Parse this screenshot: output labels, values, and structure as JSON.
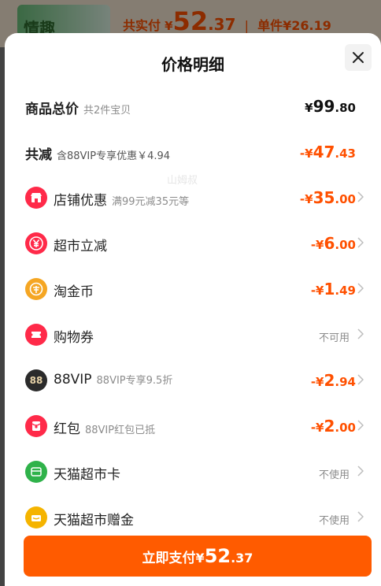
{
  "background": {
    "thumb_text": "情趣",
    "total_label": "共实付",
    "total_currency": "¥",
    "total_int": "52",
    "total_dec": ".37",
    "separator": "|",
    "unit_label": "单件",
    "unit_price": "¥26.19"
  },
  "sheet": {
    "title": "价格明细",
    "watermark": "山姆叔"
  },
  "summary": {
    "goods_total": {
      "label": "商品总价",
      "sub": "共2件宝贝",
      "currency": "¥",
      "int": "99",
      "dec": ".80"
    },
    "total_discount": {
      "label": "共减",
      "sub": "含88VIP专享优惠￥4.94",
      "sign": "-¥",
      "int": "47",
      "dec": ".43"
    }
  },
  "discounts": [
    {
      "label": "店铺优惠",
      "sub": "满99元减35元等",
      "sign": "-¥",
      "int": "35",
      "dec": ".00",
      "icon": "shop-icon",
      "color": "#ff2a49"
    },
    {
      "label": "超市立减",
      "sub": "",
      "sign": "-¥",
      "int": "6",
      "dec": ".00",
      "icon": "coupon-yen-icon",
      "color": "#ff2a49"
    },
    {
      "label": "淘金币",
      "sub": "",
      "sign": "-¥",
      "int": "1",
      "dec": ".49",
      "icon": "gold-coin-icon",
      "color": "#f5a623"
    },
    {
      "label": "购物券",
      "sub": "",
      "status": "不可用",
      "icon": "ticket-icon",
      "color": "#ff2a49"
    },
    {
      "label": "88VIP",
      "sub": "88VIP专享9.5折",
      "sign": "-¥",
      "int": "2",
      "dec": ".94",
      "icon": "vip88-icon",
      "color": "#2b2b2b"
    },
    {
      "label": "红包",
      "sub": "88VIP红包已抵",
      "sign": "-¥",
      "int": "2",
      "dec": ".00",
      "icon": "red-packet-icon",
      "color": "#ff2a49"
    },
    {
      "label": "天猫超市卡",
      "sub": "",
      "status": "不使用",
      "icon": "supermarket-card-icon",
      "color": "#2fb24a"
    },
    {
      "label": "天猫超市赠金",
      "sub": "",
      "status": "不使用",
      "icon": "gift-money-icon",
      "color": "#f5b400"
    }
  ],
  "pay_button": {
    "label": "立即支付",
    "currency": "¥",
    "int": "52",
    "dec": ".37"
  },
  "colors": {
    "accent": "#ff5000",
    "button": "#ff5b00"
  }
}
